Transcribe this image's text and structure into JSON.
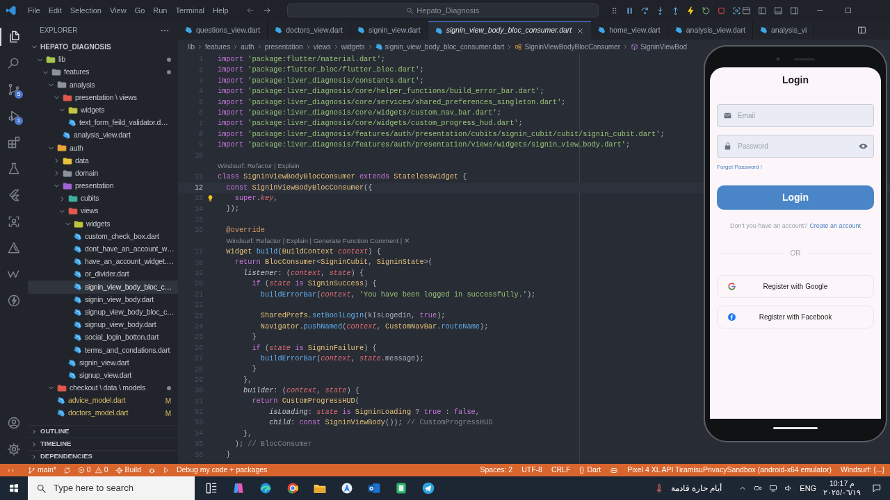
{
  "title_bar": {
    "menu": [
      "File",
      "Edit",
      "Selection",
      "View",
      "Go",
      "Run",
      "Terminal",
      "Help"
    ],
    "search": "Hepato_Diagnosis",
    "debug_tools": [
      {
        "kind": "grip"
      },
      {
        "kind": "pause"
      },
      {
        "kind": "step-over"
      },
      {
        "kind": "step-into"
      },
      {
        "kind": "step-out"
      },
      {
        "kind": "hot-reload"
      },
      {
        "kind": "restart"
      },
      {
        "kind": "stop"
      },
      {
        "kind": "inspect"
      }
    ]
  },
  "activity_bar": {
    "top": [
      {
        "kind": "files",
        "selected": true
      },
      {
        "kind": "search",
        "selected": false
      },
      {
        "kind": "source-control",
        "selected": false,
        "badge": "5"
      },
      {
        "kind": "debug",
        "selected": false,
        "badge": "1"
      },
      {
        "kind": "extensions",
        "selected": false
      },
      {
        "kind": "testing",
        "selected": false
      },
      {
        "kind": "flutter",
        "selected": false
      },
      {
        "kind": "scan",
        "selected": false
      },
      {
        "kind": "triangle",
        "selected": false
      },
      {
        "kind": "wave",
        "selected": false
      },
      {
        "kind": "bolt",
        "selected": false
      }
    ],
    "bottom": [
      {
        "kind": "account",
        "selected": false
      },
      {
        "kind": "settings",
        "selected": false
      }
    ]
  },
  "explorer": {
    "title": "EXPLORER",
    "project": "HEPATO_DIAGNOSIS",
    "tree": [
      {
        "kind": "folder",
        "label": "lib",
        "color": "#a8c64e",
        "expanded": true,
        "modified": true,
        "selected": false,
        "children": [
          {
            "kind": "folder",
            "label": "features",
            "color": "#8d939c",
            "expanded": true,
            "modified": true,
            "selected": false,
            "children": [
              {
                "kind": "folder",
                "label": "analysis",
                "color": "#8d939c",
                "expanded": true,
                "selected": false,
                "children": [
                  {
                    "kind": "folder",
                    "label": "presentation \\ views",
                    "color": "#e0584e",
                    "expanded": true,
                    "selected": false,
                    "children": [
                      {
                        "kind": "folder",
                        "label": "widgets",
                        "color": "#c2c43f",
                        "expanded": true,
                        "selected": false,
                        "children": [
                          {
                            "kind": "file",
                            "label": "text_form_feild_validator.d…",
                            "selected": false
                          }
                        ]
                      },
                      {
                        "kind": "file",
                        "label": "analysis_view.dart",
                        "selected": false
                      }
                    ]
                  }
                ]
              },
              {
                "kind": "folder",
                "label": "auth",
                "color": "#e9a23b",
                "expanded": true,
                "selected": false,
                "children": [
                  {
                    "kind": "folder",
                    "label": "data",
                    "color": "#e8c13a",
                    "expanded": false,
                    "selected": false
                  },
                  {
                    "kind": "folder",
                    "label": "domain",
                    "color": "#8d939c",
                    "expanded": false,
                    "selected": false
                  },
                  {
                    "kind": "folder",
                    "label": "presentation",
                    "color": "#a064d6",
                    "expanded": true,
                    "selected": false,
                    "children": [
                      {
                        "kind": "folder",
                        "label": "cubits",
                        "color": "#3fae9c",
                        "expanded": false,
                        "selected": false
                      },
                      {
                        "kind": "folder",
                        "label": "views",
                        "color": "#e0584e",
                        "expanded": true,
                        "selected": false,
                        "children": [
                          {
                            "kind": "folder",
                            "label": "widgets",
                            "color": "#c2c43f",
                            "expanded": true,
                            "selected": false,
                            "children": [
                              {
                                "kind": "file",
                                "label": "custom_check_box.dart",
                                "selected": false
                              },
                              {
                                "kind": "file",
                                "label": "dont_have_an_account_w…",
                                "selected": false
                              },
                              {
                                "kind": "file",
                                "label": "have_an_account_widget.…",
                                "selected": false
                              },
                              {
                                "kind": "file",
                                "label": "or_divider.dart",
                                "selected": false
                              },
                              {
                                "kind": "file",
                                "label": "signin_view_body_bloc_c…",
                                "selected": true
                              },
                              {
                                "kind": "file",
                                "label": "signin_view_body.dart",
                                "selected": false
                              },
                              {
                                "kind": "file",
                                "label": "signup_view_body_bloc_c…",
                                "selected": false
                              },
                              {
                                "kind": "file",
                                "label": "signup_view_body.dart",
                                "selected": false
                              },
                              {
                                "kind": "file",
                                "label": "social_login_botton.dart",
                                "selected": false
                              },
                              {
                                "kind": "file",
                                "label": "terms_and_condations.dart",
                                "selected": false
                              }
                            ]
                          },
                          {
                            "kind": "file",
                            "label": "signin_view.dart",
                            "selected": false
                          },
                          {
                            "kind": "file",
                            "label": "signup_view.dart",
                            "selected": false
                          }
                        ]
                      }
                    ]
                  }
                ]
              },
              {
                "kind": "folder",
                "label": "checkout \\ data \\ models",
                "color": "#e0584e",
                "expanded": true,
                "modified": true,
                "selected": false,
                "children": [
                  {
                    "kind": "file",
                    "label": "advice_model.dart",
                    "badge": "M",
                    "selected": false
                  },
                  {
                    "kind": "file",
                    "label": "doctors_model.dart",
                    "badge": "M",
                    "selected": false
                  }
                ]
              }
            ]
          }
        ]
      }
    ],
    "sections": [
      "OUTLINE",
      "TIMELINE",
      "DEPENDENCIES"
    ]
  },
  "tabs": [
    {
      "label": "questions_view.dart",
      "selected": false
    },
    {
      "label": "doctors_view.dart",
      "selected": false
    },
    {
      "label": "signin_view.dart",
      "selected": false
    },
    {
      "label": "signin_view_body_bloc_consumer.dart",
      "selected": true
    },
    {
      "label": "home_view.dart",
      "selected": false
    },
    {
      "label": "analysis_view.dart",
      "selected": false
    },
    {
      "label": "analysis_vi",
      "selected": false
    }
  ],
  "breadcrumbs": [
    {
      "kind": "folder",
      "text": "lib"
    },
    {
      "kind": "folder",
      "text": "features"
    },
    {
      "kind": "folder",
      "text": "auth"
    },
    {
      "kind": "folder",
      "text": "presentation"
    },
    {
      "kind": "folder",
      "text": "views"
    },
    {
      "kind": "folder",
      "text": "widgets"
    },
    {
      "kind": "file",
      "text": "signin_view_body_bloc_consumer.dart"
    },
    {
      "kind": "class",
      "text": "SigninViewBodyBlocConsumer"
    },
    {
      "kind": "method",
      "text": "SigninViewBod"
    }
  ],
  "editor": {
    "lines": [
      {
        "kind": "code",
        "number": "1",
        "active": false,
        "tokens": [
          {
            "kind": "keyword",
            "text": "import "
          },
          {
            "kind": "string",
            "text": "'package:flutter/material.dart'"
          },
          {
            "kind": "plain",
            "text": ";"
          }
        ]
      },
      {
        "kind": "code",
        "number": "2",
        "active": false,
        "tokens": [
          {
            "kind": "keyword",
            "text": "import "
          },
          {
            "kind": "string",
            "text": "'package:flutter_bloc/flutter_bloc.dart'"
          },
          {
            "kind": "plain",
            "text": ";"
          }
        ]
      },
      {
        "kind": "code",
        "number": "3",
        "active": false,
        "tokens": [
          {
            "kind": "keyword",
            "text": "import "
          },
          {
            "kind": "string",
            "text": "'package:liver_diagnosis/constants.dart'"
          },
          {
            "kind": "plain",
            "text": ";"
          }
        ]
      },
      {
        "kind": "code",
        "number": "4",
        "active": false,
        "tokens": [
          {
            "kind": "keyword",
            "text": "import "
          },
          {
            "kind": "string",
            "text": "'package:liver_diagnosis/core/helper_functions/build_error_bar.dart'"
          },
          {
            "kind": "plain",
            "text": ";"
          }
        ]
      },
      {
        "kind": "code",
        "number": "5",
        "active": false,
        "tokens": [
          {
            "kind": "keyword",
            "text": "import "
          },
          {
            "kind": "string",
            "text": "'package:liver_diagnosis/core/services/shared_preferences_singleton.dart'"
          },
          {
            "kind": "plain",
            "text": ";"
          }
        ]
      },
      {
        "kind": "code",
        "number": "6",
        "active": false,
        "tokens": [
          {
            "kind": "keyword",
            "text": "import "
          },
          {
            "kind": "string",
            "text": "'package:liver_diagnosis/core/widgets/custom_nav_bar.dart'"
          },
          {
            "kind": "plain",
            "text": ";"
          }
        ]
      },
      {
        "kind": "code",
        "number": "7",
        "active": false,
        "tokens": [
          {
            "kind": "keyword",
            "text": "import "
          },
          {
            "kind": "string",
            "text": "'package:liver_diagnosis/core/widgets/custom_progress_hud.dart'"
          },
          {
            "kind": "plain",
            "text": ";"
          }
        ]
      },
      {
        "kind": "code",
        "number": "8",
        "active": false,
        "tokens": [
          {
            "kind": "keyword",
            "text": "import "
          },
          {
            "kind": "string",
            "text": "'package:liver_diagnosis/features/auth/presentation/cubits/signin_cubit/cubit/signin_cubit.dart'"
          },
          {
            "kind": "plain",
            "text": ";"
          }
        ]
      },
      {
        "kind": "code",
        "number": "9",
        "active": false,
        "tokens": [
          {
            "kind": "keyword",
            "text": "import "
          },
          {
            "kind": "string",
            "text": "'package:liver_diagnosis/features/auth/presentation/views/widgets/signin_view_body.dart'"
          },
          {
            "kind": "plain",
            "text": ";"
          }
        ]
      },
      {
        "kind": "code",
        "number": "10",
        "active": false
      },
      {
        "kind": "lens",
        "text": "Windsurf: Refactor | Explain"
      },
      {
        "kind": "code",
        "number": "11",
        "active": false,
        "tokens": [
          {
            "kind": "keyword",
            "text": "class "
          },
          {
            "kind": "type",
            "text": "SigninViewBodyBlocConsumer "
          },
          {
            "kind": "keyword",
            "text": "extends "
          },
          {
            "kind": "type",
            "text": "StatelessWidget "
          },
          {
            "kind": "plain",
            "text": "{"
          }
        ]
      },
      {
        "kind": "code",
        "number": "12",
        "active": true,
        "tokens": [
          {
            "kind": "keyword",
            "text": "  const "
          },
          {
            "kind": "type",
            "text": "SigninViewBodyBlocConsumer"
          },
          {
            "kind": "plain",
            "text": "({"
          }
        ]
      },
      {
        "kind": "code",
        "number": "13",
        "active": false,
        "lightbulb": true,
        "tokens": [
          {
            "kind": "keyword",
            "text": "    super"
          },
          {
            "kind": "plain",
            "text": "."
          },
          {
            "kind": "param",
            "text": "key"
          },
          {
            "kind": "plain",
            "text": ","
          }
        ]
      },
      {
        "kind": "code",
        "number": "14",
        "active": false,
        "tokens": [
          {
            "kind": "plain",
            "text": "  });"
          }
        ]
      },
      {
        "kind": "code",
        "number": "15",
        "active": false
      },
      {
        "kind": "code",
        "number": "16",
        "active": false,
        "tokens": [
          {
            "kind": "annotation",
            "text": "  @override"
          }
        ]
      },
      {
        "kind": "lens",
        "text": "Windsurf: Refactor | Explain | Generate Function Comment | ✕"
      },
      {
        "kind": "code",
        "number": "17",
        "active": false,
        "tokens": [
          {
            "kind": "type",
            "text": "  Widget "
          },
          {
            "kind": "function",
            "text": "build"
          },
          {
            "kind": "plain",
            "text": "("
          },
          {
            "kind": "type",
            "text": "BuildContext "
          },
          {
            "kind": "param",
            "text": "context"
          },
          {
            "kind": "plain",
            "text": ") {"
          }
        ]
      },
      {
        "kind": "code",
        "number": "18",
        "active": false,
        "tokens": [
          {
            "kind": "keyword",
            "text": "    return "
          },
          {
            "kind": "type",
            "text": "BlocConsumer"
          },
          {
            "kind": "plain",
            "text": "<"
          },
          {
            "kind": "type",
            "text": "SigninCubit"
          },
          {
            "kind": "plain",
            "text": ", "
          },
          {
            "kind": "type",
            "text": "SigninState"
          },
          {
            "kind": "plain",
            "text": ">("
          }
        ]
      },
      {
        "kind": "code",
        "number": "19",
        "active": false,
        "tokens": [
          {
            "kind": "label",
            "text": "      listener"
          },
          {
            "kind": "plain",
            "text": ": ("
          },
          {
            "kind": "param",
            "text": "context"
          },
          {
            "kind": "plain",
            "text": ", "
          },
          {
            "kind": "param",
            "text": "state"
          },
          {
            "kind": "plain",
            "text": ") {"
          }
        ]
      },
      {
        "kind": "code",
        "number": "20",
        "active": false,
        "tokens": [
          {
            "kind": "keyword",
            "text": "        if"
          },
          {
            "kind": "plain",
            "text": " ("
          },
          {
            "kind": "param",
            "text": "state "
          },
          {
            "kind": "keyword",
            "text": "is "
          },
          {
            "kind": "type",
            "text": "SigninSuccess"
          },
          {
            "kind": "plain",
            "text": ") {"
          }
        ]
      },
      {
        "kind": "code",
        "number": "21",
        "active": false,
        "tokens": [
          {
            "kind": "function",
            "text": "          buildErrorBar"
          },
          {
            "kind": "plain",
            "text": "("
          },
          {
            "kind": "param",
            "text": "context"
          },
          {
            "kind": "plain",
            "text": ", "
          },
          {
            "kind": "string",
            "text": "'You have been logged in successfully.'"
          },
          {
            "kind": "plain",
            "text": ");"
          }
        ]
      },
      {
        "kind": "code",
        "number": "22",
        "active": false
      },
      {
        "kind": "code",
        "number": "23",
        "active": false,
        "tokens": [
          {
            "kind": "type",
            "text": "          SharedPrefs"
          },
          {
            "kind": "plain",
            "text": "."
          },
          {
            "kind": "function",
            "text": "setBoolLogin"
          },
          {
            "kind": "plain",
            "text": "(kIsLogedin, "
          },
          {
            "kind": "keyword",
            "text": "true"
          },
          {
            "kind": "plain",
            "text": ");"
          }
        ]
      },
      {
        "kind": "code",
        "number": "24",
        "active": false,
        "tokens": [
          {
            "kind": "type",
            "text": "          Navigator"
          },
          {
            "kind": "plain",
            "text": "."
          },
          {
            "kind": "function",
            "text": "pushNamed"
          },
          {
            "kind": "plain",
            "text": "("
          },
          {
            "kind": "param",
            "text": "context"
          },
          {
            "kind": "plain",
            "text": ", "
          },
          {
            "kind": "type",
            "text": "CustomNavBar"
          },
          {
            "kind": "plain",
            "text": "."
          },
          {
            "kind": "function",
            "text": "routeName"
          },
          {
            "kind": "plain",
            "text": ");"
          }
        ]
      },
      {
        "kind": "code",
        "number": "25",
        "active": false,
        "tokens": [
          {
            "kind": "plain",
            "text": "        }"
          }
        ]
      },
      {
        "kind": "code",
        "number": "26",
        "active": false,
        "tokens": [
          {
            "kind": "keyword",
            "text": "        if"
          },
          {
            "kind": "plain",
            "text": " ("
          },
          {
            "kind": "param",
            "text": "state "
          },
          {
            "kind": "keyword",
            "text": "is "
          },
          {
            "kind": "type",
            "text": "SigninFailure"
          },
          {
            "kind": "plain",
            "text": ") {"
          }
        ]
      },
      {
        "kind": "code",
        "number": "27",
        "active": false,
        "tokens": [
          {
            "kind": "function",
            "text": "          buildErrorBar"
          },
          {
            "kind": "plain",
            "text": "("
          },
          {
            "kind": "param",
            "text": "context"
          },
          {
            "kind": "plain",
            "text": ", "
          },
          {
            "kind": "param",
            "text": "state"
          },
          {
            "kind": "plain",
            "text": ".message);"
          }
        ]
      },
      {
        "kind": "code",
        "number": "28",
        "active": false,
        "tokens": [
          {
            "kind": "plain",
            "text": "        }"
          }
        ]
      },
      {
        "kind": "code",
        "number": "29",
        "active": false,
        "tokens": [
          {
            "kind": "plain",
            "text": "      },"
          }
        ]
      },
      {
        "kind": "code",
        "number": "30",
        "active": false,
        "tokens": [
          {
            "kind": "label",
            "text": "      builder"
          },
          {
            "kind": "plain",
            "text": ": ("
          },
          {
            "kind": "param",
            "text": "context"
          },
          {
            "kind": "plain",
            "text": ", "
          },
          {
            "kind": "param",
            "text": "state"
          },
          {
            "kind": "plain",
            "text": ") {"
          }
        ]
      },
      {
        "kind": "code",
        "number": "31",
        "active": false,
        "tokens": [
          {
            "kind": "keyword",
            "text": "        return "
          },
          {
            "kind": "type",
            "text": "CustomProgressHUD"
          },
          {
            "kind": "plain",
            "text": "("
          }
        ]
      },
      {
        "kind": "code",
        "number": "32",
        "active": false,
        "tokens": [
          {
            "kind": "label",
            "text": "            isLoading"
          },
          {
            "kind": "plain",
            "text": ": "
          },
          {
            "kind": "param",
            "text": "state "
          },
          {
            "kind": "keyword",
            "text": "is "
          },
          {
            "kind": "type",
            "text": "SigninLoading"
          },
          {
            "kind": "plain",
            "text": " ? "
          },
          {
            "kind": "keyword",
            "text": "true"
          },
          {
            "kind": "plain",
            "text": " : "
          },
          {
            "kind": "keyword",
            "text": "false"
          },
          {
            "kind": "plain",
            "text": ","
          }
        ]
      },
      {
        "kind": "code",
        "number": "33",
        "active": false,
        "tokens": [
          {
            "kind": "label",
            "text": "            child"
          },
          {
            "kind": "plain",
            "text": ": "
          },
          {
            "kind": "keyword",
            "text": "const "
          },
          {
            "kind": "type",
            "text": "SigninViewBody"
          },
          {
            "kind": "plain",
            "text": "()); "
          },
          {
            "kind": "comment",
            "text": "// CustomProgressHUD"
          }
        ]
      },
      {
        "kind": "code",
        "number": "34",
        "active": false,
        "tokens": [
          {
            "kind": "plain",
            "text": "      },"
          }
        ]
      },
      {
        "kind": "code",
        "number": "35",
        "active": false,
        "tokens": [
          {
            "kind": "plain",
            "text": "    ); "
          },
          {
            "kind": "comment",
            "text": "// BlocConsumer"
          }
        ]
      },
      {
        "kind": "code",
        "number": "36",
        "active": false,
        "tokens": [
          {
            "kind": "plain",
            "text": "  }"
          }
        ]
      }
    ]
  },
  "emulator": {
    "title": "Login",
    "email": {
      "placeholder": "Email"
    },
    "password": {
      "placeholder": "Password"
    },
    "forgot": "Forget Password !",
    "login_button": "Login",
    "signup_prompt": "Don't you have an account?",
    "signup_link": "Create an account",
    "divider": "OR",
    "social": [
      {
        "kind": "google",
        "label": "Register with Google"
      },
      {
        "kind": "facebook",
        "label": "Register with Facebook"
      }
    ]
  },
  "status_bar": {
    "left": [
      {
        "kind": "remote"
      },
      {
        "kind": "branch",
        "text": "main*"
      },
      {
        "kind": "sync"
      },
      {
        "kind": "problems",
        "errors": "0",
        "warnings": "0"
      },
      {
        "kind": "build",
        "text": "Build"
      },
      {
        "kind": "debug"
      },
      {
        "kind": "run",
        "text": "Debug my code + packages"
      }
    ],
    "right": [
      {
        "kind": "text",
        "text": "Spaces: 2"
      },
      {
        "kind": "text",
        "text": "UTF-8"
      },
      {
        "kind": "text",
        "text": "CRLF"
      },
      {
        "kind": "lang",
        "icon": "{}",
        "text": "Dart"
      },
      {
        "kind": "copilot"
      },
      {
        "kind": "text",
        "text": "Pixel 4 XL API TiramisuPrivacySandbox (android-x64 emulator)"
      },
      {
        "kind": "text",
        "text": "Windsurf: {...}"
      }
    ]
  },
  "taskbar": {
    "search": {
      "placeholder": "Type here to search"
    },
    "apps": [
      {
        "kind": "taskview"
      },
      {
        "kind": "copilot"
      },
      {
        "kind": "edge"
      },
      {
        "kind": "chrome"
      },
      {
        "kind": "files"
      },
      {
        "kind": "android"
      },
      {
        "kind": "outlook"
      },
      {
        "kind": "notes"
      },
      {
        "kind": "telegram"
      }
    ],
    "weather": "أيام حارة قادمة",
    "language": "ENG",
    "time": "10:17 م",
    "date": "٢٠٢٥/٠٦/١٩"
  }
}
